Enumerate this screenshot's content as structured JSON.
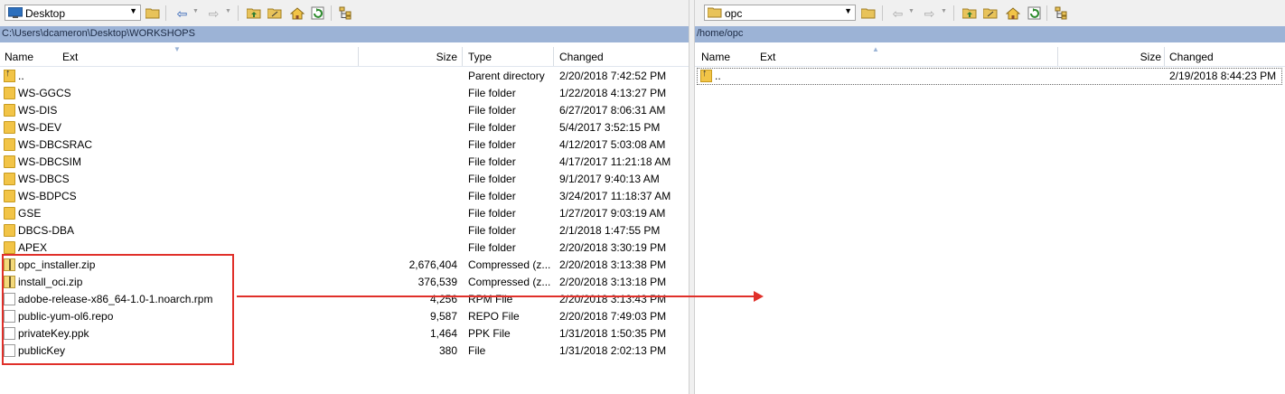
{
  "left": {
    "location": "Desktop",
    "path": "C:\\Users\\dcameron\\Desktop\\WORKSHOPS",
    "columns": {
      "name": "Name",
      "ext": "Ext",
      "size": "Size",
      "type": "Type",
      "changed": "Changed"
    },
    "rows": [
      {
        "icon": "up-dir-icon",
        "name": "..",
        "size": "",
        "type": "Parent directory",
        "changed": "2/20/2018  7:42:52 PM"
      },
      {
        "icon": "folder-icon",
        "name": "WS-GGCS",
        "size": "",
        "type": "File folder",
        "changed": "1/22/2018  4:13:27 PM"
      },
      {
        "icon": "folder-icon",
        "name": "WS-DIS",
        "size": "",
        "type": "File folder",
        "changed": "6/27/2017  8:06:31 AM"
      },
      {
        "icon": "folder-icon",
        "name": "WS-DEV",
        "size": "",
        "type": "File folder",
        "changed": "5/4/2017  3:52:15 PM"
      },
      {
        "icon": "folder-icon",
        "name": "WS-DBCSRAC",
        "size": "",
        "type": "File folder",
        "changed": "4/12/2017  5:03:08 AM"
      },
      {
        "icon": "folder-icon",
        "name": "WS-DBCSIM",
        "size": "",
        "type": "File folder",
        "changed": "4/17/2017  11:21:18 AM"
      },
      {
        "icon": "folder-icon",
        "name": "WS-DBCS",
        "size": "",
        "type": "File folder",
        "changed": "9/1/2017  9:40:13 AM"
      },
      {
        "icon": "folder-icon",
        "name": "WS-BDPCS",
        "size": "",
        "type": "File folder",
        "changed": "3/24/2017  11:18:37 AM"
      },
      {
        "icon": "folder-icon",
        "name": "GSE",
        "size": "",
        "type": "File folder",
        "changed": "1/27/2017  9:03:19 AM"
      },
      {
        "icon": "folder-icon",
        "name": "DBCS-DBA",
        "size": "",
        "type": "File folder",
        "changed": "2/1/2018  1:47:55 PM"
      },
      {
        "icon": "folder-icon",
        "name": "APEX",
        "size": "",
        "type": "File folder",
        "changed": "2/20/2018  3:30:19 PM"
      },
      {
        "icon": "zip-icon",
        "name": "opc_installer.zip",
        "size": "2,676,404",
        "type": "Compressed (z...",
        "changed": "2/20/2018  3:13:38 PM"
      },
      {
        "icon": "zip-icon",
        "name": "install_oci.zip",
        "size": "376,539",
        "type": "Compressed (z...",
        "changed": "2/20/2018  3:13:18 PM"
      },
      {
        "icon": "file-icon",
        "name": "adobe-release-x86_64-1.0-1.noarch.rpm",
        "size": "4,256",
        "type": "RPM File",
        "changed": "2/20/2018  3:13:43 PM"
      },
      {
        "icon": "file-icon",
        "name": "public-yum-ol6.repo",
        "size": "9,587",
        "type": "REPO File",
        "changed": "2/20/2018  7:49:03 PM"
      },
      {
        "icon": "file-icon",
        "name": "privateKey.ppk",
        "size": "1,464",
        "type": "PPK File",
        "changed": "1/31/2018  1:50:35 PM"
      },
      {
        "icon": "file-icon",
        "name": "publicKey",
        "size": "380",
        "type": "File",
        "changed": "1/31/2018  2:02:13 PM"
      }
    ]
  },
  "right": {
    "location": "opc",
    "path": "/home/opc",
    "columns": {
      "name": "Name",
      "ext": "Ext",
      "size": "Size",
      "changed": "Changed"
    },
    "rows": [
      {
        "icon": "up-dir-icon",
        "name": "..",
        "size": "",
        "changed": "2/19/2018 8:44:23 PM"
      }
    ]
  },
  "annotation": {
    "color": "#e0302a"
  },
  "colors": {
    "path_bar": "#9cb3d6",
    "toolbar": "#f0f0f0",
    "folder": "#f2c447"
  }
}
